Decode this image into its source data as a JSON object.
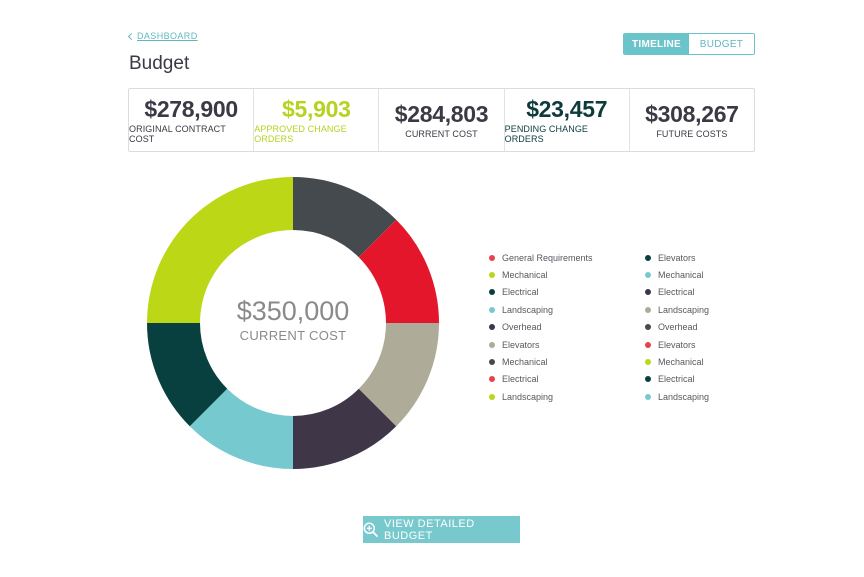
{
  "nav": {
    "back_label": "DASHBOARD"
  },
  "page": {
    "title": "Budget"
  },
  "toggle": {
    "timeline_label": "TIMELINE",
    "budget_label": "BUDGET",
    "active": "TIMELINE"
  },
  "stats": [
    {
      "value": "$278,900",
      "label": "ORIGINAL CONTRACT COST",
      "color": "#3a3a45"
    },
    {
      "value": "$5,903",
      "label": "APPROVED CHANGE ORDERS",
      "color": "#b5d321"
    },
    {
      "value": "$284,803",
      "label": "CURRENT COST",
      "color": "#3a3a45"
    },
    {
      "value": "$23,457",
      "label": "PENDING CHANGE ORDERS",
      "color": "#0d3b3b"
    },
    {
      "value": "$308,267",
      "label": "FUTURE COSTS",
      "color": "#3a3a45"
    }
  ],
  "donut": {
    "center_value": "$350,000",
    "center_label": "CURRENT COST",
    "segments": [
      {
        "color": "#454a4e",
        "fraction": 0.125
      },
      {
        "color": "#e3162c",
        "fraction": 0.125
      },
      {
        "color": "#aeac98",
        "fraction": 0.125
      },
      {
        "color": "#3f3648",
        "fraction": 0.125
      },
      {
        "color": "#76c9ce",
        "fraction": 0.125
      },
      {
        "color": "#07403e",
        "fraction": 0.125
      },
      {
        "color": "#bbd716",
        "fraction": 0.25
      }
    ]
  },
  "legend": {
    "col1": [
      {
        "label": "General Requirements",
        "color": "#e8434d"
      },
      {
        "label": "Mechanical",
        "color": "#bbd716"
      },
      {
        "label": "Electrical",
        "color": "#07403e"
      },
      {
        "label": "Landscaping",
        "color": "#76c9ce"
      },
      {
        "label": "Overhead",
        "color": "#3f3648"
      },
      {
        "label": "Elevators",
        "color": "#aeac98"
      },
      {
        "label": "Mechanical",
        "color": "#454a4e"
      },
      {
        "label": "Electrical",
        "color": "#e8434d"
      },
      {
        "label": "Landscaping",
        "color": "#bbd716"
      }
    ],
    "col2": [
      {
        "label": "Elevators",
        "color": "#07403e"
      },
      {
        "label": "Mechanical",
        "color": "#76c9ce"
      },
      {
        "label": "Electrical",
        "color": "#3f3648"
      },
      {
        "label": "Landscaping",
        "color": "#aeac98"
      },
      {
        "label": "Overhead",
        "color": "#454a4e"
      },
      {
        "label": "Elevators",
        "color": "#e8434d"
      },
      {
        "label": "Mechanical",
        "color": "#bbd716"
      },
      {
        "label": "Electrical",
        "color": "#07403e"
      },
      {
        "label": "Landscaping",
        "color": "#76c9ce"
      }
    ]
  },
  "cta": {
    "label": "VIEW DETAILED BUDGET",
    "icon": "zoom-in-icon"
  }
}
